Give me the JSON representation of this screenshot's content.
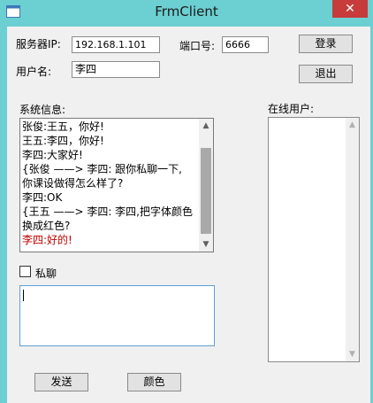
{
  "window": {
    "title": "FrmClient",
    "close_glyph": "✕"
  },
  "server": {
    "ip_label": "服务器IP:",
    "ip_value": "192.168.1.101",
    "port_label": "端口号:",
    "port_value": "6666"
  },
  "user": {
    "name_label": "用户名:",
    "name_value": "李四"
  },
  "buttons": {
    "login": "登录",
    "exit": "退出",
    "send": "发送",
    "color": "颜色"
  },
  "system_info": {
    "label": "系统信息:",
    "lines": [
      {
        "text": "张俊:王五，你好!",
        "color": "#000000"
      },
      {
        "text": "王五:李四，你好!",
        "color": "#000000"
      },
      {
        "text": "李四:大家好!",
        "color": "#000000"
      },
      {
        "text": "{张俊 ——> 李四:  跟你私聊一下,",
        "color": "#000000"
      },
      {
        "text": "你课设做得怎么样了?",
        "color": "#000000"
      },
      {
        "text": "李四:OK",
        "color": "#000000"
      },
      {
        "text": "{王五 ——> 李四:  李四,把字体颜色",
        "color": "#000000"
      },
      {
        "text": "换成红色?",
        "color": "#000000"
      },
      {
        "text": "李四:好的!",
        "color": "#c00000"
      }
    ],
    "scroll_up_glyph": "▲",
    "scroll_down_glyph": "▼"
  },
  "private_chat": {
    "label": "私聊",
    "checked": false
  },
  "message_input": {
    "value": ""
  },
  "online_users": {
    "label": "在线用户:",
    "scroll_up_glyph": "▲",
    "scroll_down_glyph": "▼"
  },
  "colors": {
    "titlebar": "#6ccfd2",
    "close_button": "#c73b3b",
    "red_text": "#c00000",
    "focus_border": "#5e9ed6"
  }
}
